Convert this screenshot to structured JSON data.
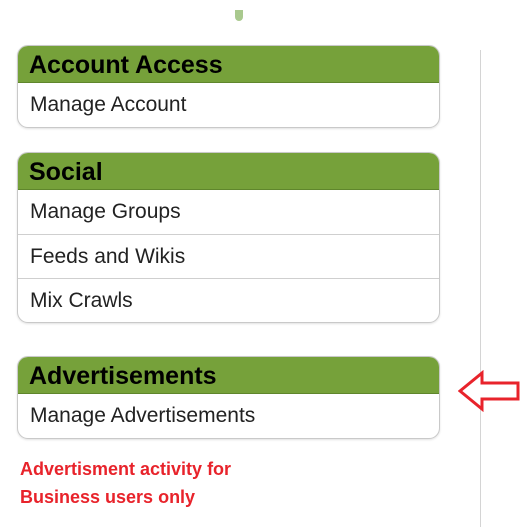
{
  "sections": [
    {
      "title": "Account Access",
      "items": [
        "Manage Account"
      ]
    },
    {
      "title": "Social",
      "items": [
        "Manage Groups",
        "Feeds and Wikis",
        "Mix Crawls"
      ]
    },
    {
      "title": "Advertisements",
      "items": [
        "Manage Advertisements"
      ]
    }
  ],
  "annotation": {
    "line1": "Advertisment activity for",
    "line2": "Business users only",
    "color": "#e8232b"
  },
  "icons": {
    "pointer": "left-arrow-icon"
  },
  "colors": {
    "header_bg": "#76a13a",
    "arrow": "#e8232b"
  }
}
